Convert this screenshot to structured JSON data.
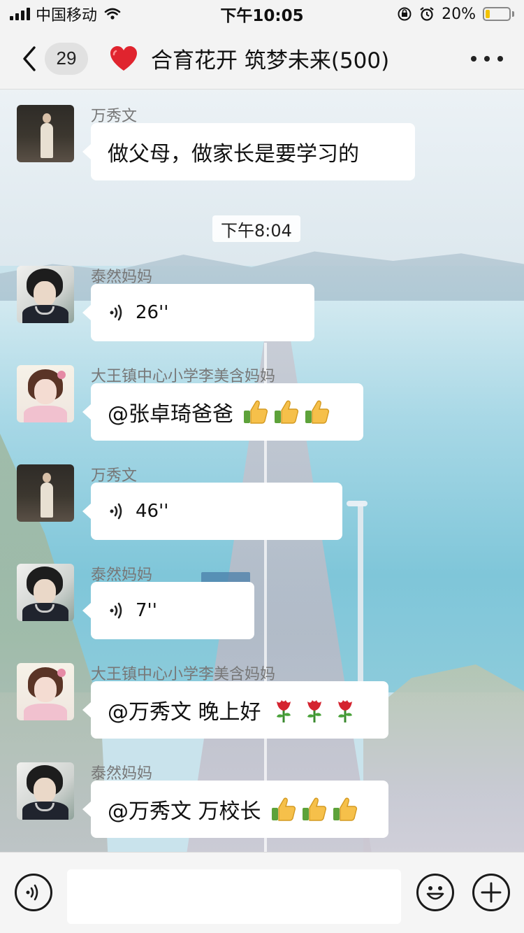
{
  "status_bar": {
    "carrier": "中国移动",
    "time": "下午10:05",
    "battery_percent": "20%",
    "battery_level": 0.2,
    "icons": [
      "signal-icon",
      "wifi-icon",
      "rotation-lock-icon",
      "alarm-icon",
      "battery-icon"
    ]
  },
  "nav": {
    "unread_count": "29",
    "title": "合育花开 筑梦未来(500)",
    "icons": [
      "back-chevron-icon",
      "heart-icon",
      "more-dots-icon"
    ]
  },
  "chat": {
    "time_divider": "下午8:04",
    "messages": [
      {
        "sender": "万秀文",
        "type": "text",
        "text": "做父母，做家长是要学习的",
        "avatar": "wan-avatar"
      },
      {
        "sender": "泰然妈妈",
        "type": "voice",
        "duration": "26''",
        "avatar": "tai-avatar"
      },
      {
        "sender": "大王镇中心小学李美含妈妈",
        "type": "text",
        "text": "@张卓琦爸爸",
        "emoji": "thumbs-up",
        "emoji_count": 3,
        "avatar": "da-avatar"
      },
      {
        "sender": "万秀文",
        "type": "voice",
        "duration": "46''",
        "avatar": "wan-avatar"
      },
      {
        "sender": "泰然妈妈",
        "type": "voice",
        "duration": "7''",
        "avatar": "tai-avatar"
      },
      {
        "sender": "大王镇中心小学李美含妈妈",
        "type": "text",
        "text": "@万秀文 晚上好",
        "emoji": "rose",
        "emoji_count": 3,
        "avatar": "da-avatar"
      },
      {
        "sender": "泰然妈妈",
        "type": "text",
        "text": "@万秀文 万校长",
        "emoji": "thumbs-up",
        "emoji_count": 3,
        "avatar": "tai-avatar"
      }
    ]
  },
  "input_bar": {
    "value": "",
    "icons": [
      "voice-input-icon",
      "emoji-smile-icon",
      "plus-circle-icon"
    ]
  }
}
